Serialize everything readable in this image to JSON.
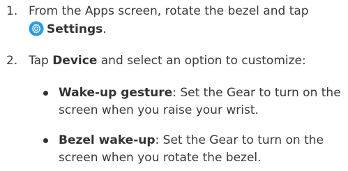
{
  "steps": [
    {
      "number": "1.",
      "line1": "From the Apps screen, rotate the bezel and tap",
      "line2_bold": "Settings",
      "line2_end": ".",
      "icon": "settings-gear-icon",
      "icon_color": "#2a9be0"
    },
    {
      "number": "2.",
      "bold": "Device",
      "text": " and select an option to customize:",
      "prefix": "Tap "
    }
  ],
  "options": [
    {
      "bold": "Wake-up gesture",
      "line1_rest": ": Set the Gear to turn on the",
      "line2": "screen when you raise your wrist."
    },
    {
      "bold": "Bezel wake-up",
      "line1_rest": ": Set the Gear to turn on the",
      "line2": "screen when you rotate the bezel."
    }
  ]
}
